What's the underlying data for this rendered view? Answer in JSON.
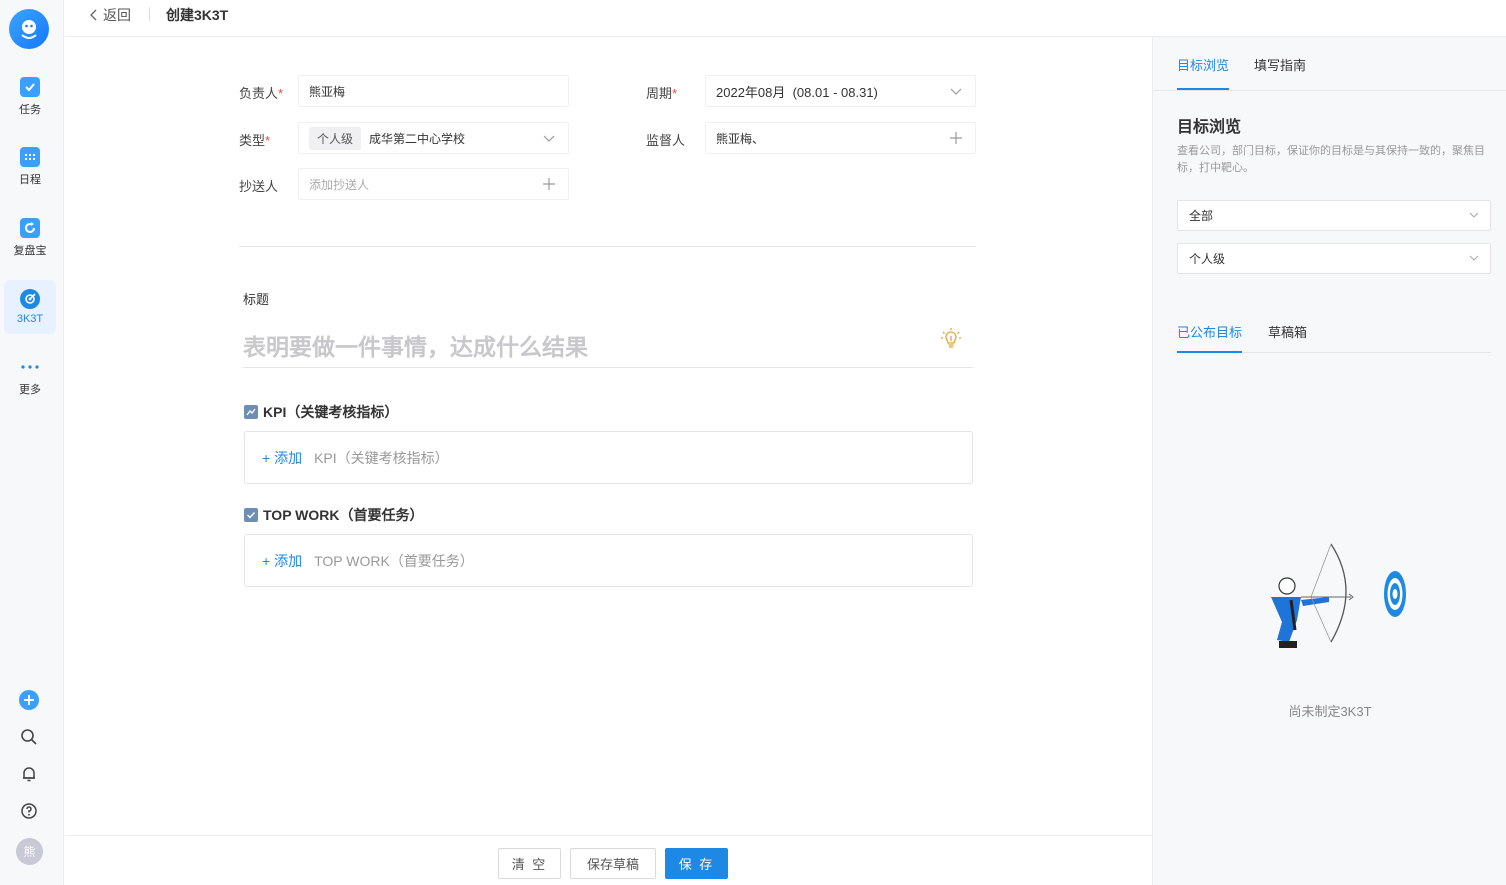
{
  "sidebar": {
    "items": [
      {
        "label": "任务",
        "icon": "task-icon"
      },
      {
        "label": "日程",
        "icon": "calendar-icon"
      },
      {
        "label": "复盘宝",
        "icon": "refresh-icon"
      },
      {
        "label": "3K3T",
        "icon": "target-icon",
        "active": true
      },
      {
        "label": "更多",
        "icon": "more-icon"
      }
    ],
    "avatar_text": "熊"
  },
  "topbar": {
    "back_label": "返回",
    "title": "创建3K3T"
  },
  "form": {
    "owner_label": "负责人",
    "owner_value": "熊亚梅",
    "period_label": "周期",
    "period_value": "2022年08月  (08.01 - 08.31)",
    "type_label": "类型",
    "type_tag": "个人级",
    "type_value": "成华第二中心学校",
    "supervisor_label": "监督人",
    "supervisor_value": "熊亚梅、",
    "cc_label": "抄送人",
    "cc_placeholder": "添加抄送人",
    "title_label": "标题",
    "title_placeholder": "表明要做一件事情，达成什么结果",
    "kpi_heading": "KPI（关键考核指标）",
    "kpi_add_link": "+ 添加",
    "kpi_add_text": "KPI（关键考核指标）",
    "topwork_heading": "TOP WORK（首要任务）",
    "topwork_add_link": "+ 添加",
    "topwork_add_text": "TOP WORK（首要任务）"
  },
  "actions": {
    "clear": "清 空",
    "save_draft": "保存草稿",
    "save": "保 存"
  },
  "right_panel": {
    "tabs": [
      {
        "label": "目标浏览",
        "active": true
      },
      {
        "label": "填写指南",
        "active": false
      }
    ],
    "title": "目标浏览",
    "description": "查看公司，部门目标，保证你的目标是与其保持一致的，聚焦目标，打中靶心。",
    "filter_scope": "全部",
    "filter_level": "个人级",
    "subtabs": [
      {
        "label": "已公布目标",
        "active": true
      },
      {
        "label": "草稿箱",
        "active": false
      }
    ],
    "empty_text": "尚未制定3K3T"
  },
  "colors": {
    "accent": "#1e88e5",
    "required": "#f5483b"
  }
}
